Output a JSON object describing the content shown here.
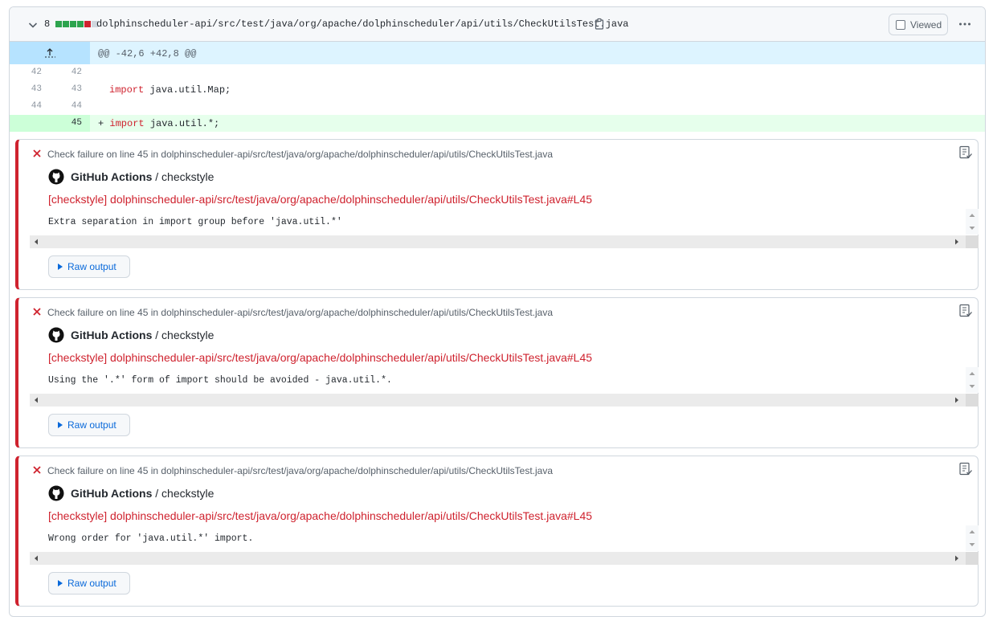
{
  "file": {
    "change_count": "8",
    "path": "dolphinscheduler-api/src/test/java/org/apache/dolphinscheduler/api/utils/CheckUtilsTest.java",
    "viewed_label": "Viewed",
    "diffstat": [
      "#2da44e",
      "#2da44e",
      "#2da44e",
      "#2da44e",
      "#cf222e",
      "#d0d7de"
    ]
  },
  "hunk": {
    "header": "@@ -42,6 +42,8 @@"
  },
  "code_lines": [
    {
      "old": "42",
      "new": "42",
      "sign": "",
      "keyword": "",
      "text": ""
    },
    {
      "old": "43",
      "new": "43",
      "sign": "",
      "keyword": "import",
      "text": " java.util.Map;"
    },
    {
      "old": "44",
      "new": "44",
      "sign": "",
      "keyword": "",
      "text": ""
    },
    {
      "old": "",
      "new": "45",
      "sign": "+ ",
      "keyword": "import",
      "text": " java.util.*;"
    }
  ],
  "annotations": [
    {
      "title": "Check failure on line 45 in dolphinscheduler-api/src/test/java/org/apache/dolphinscheduler/api/utils/CheckUtilsTest.java",
      "app": "GitHub Actions",
      "check": " / checkstyle",
      "link": "[checkstyle] dolphinscheduler-api/src/test/java/org/apache/dolphinscheduler/api/utils/CheckUtilsTest.java#L45",
      "message": "Extra separation in import group before 'java.util.*'",
      "raw_label": "Raw output"
    },
    {
      "title": "Check failure on line 45 in dolphinscheduler-api/src/test/java/org/apache/dolphinscheduler/api/utils/CheckUtilsTest.java",
      "app": "GitHub Actions",
      "check": " / checkstyle",
      "link": "[checkstyle] dolphinscheduler-api/src/test/java/org/apache/dolphinscheduler/api/utils/CheckUtilsTest.java#L45",
      "message": "Using the '.*' form of import should be avoided - java.util.*.",
      "raw_label": "Raw output"
    },
    {
      "title": "Check failure on line 45 in dolphinscheduler-api/src/test/java/org/apache/dolphinscheduler/api/utils/CheckUtilsTest.java",
      "app": "GitHub Actions",
      "check": " / checkstyle",
      "link": "[checkstyle] dolphinscheduler-api/src/test/java/org/apache/dolphinscheduler/api/utils/CheckUtilsTest.java#L45",
      "message": "Wrong order for 'java.util.*' import.",
      "raw_label": "Raw output"
    }
  ],
  "colors": {
    "failure": "#cf222e",
    "link": "#0969da",
    "added_bg": "#e6ffec",
    "hunk_bg": "#ddf4ff"
  }
}
